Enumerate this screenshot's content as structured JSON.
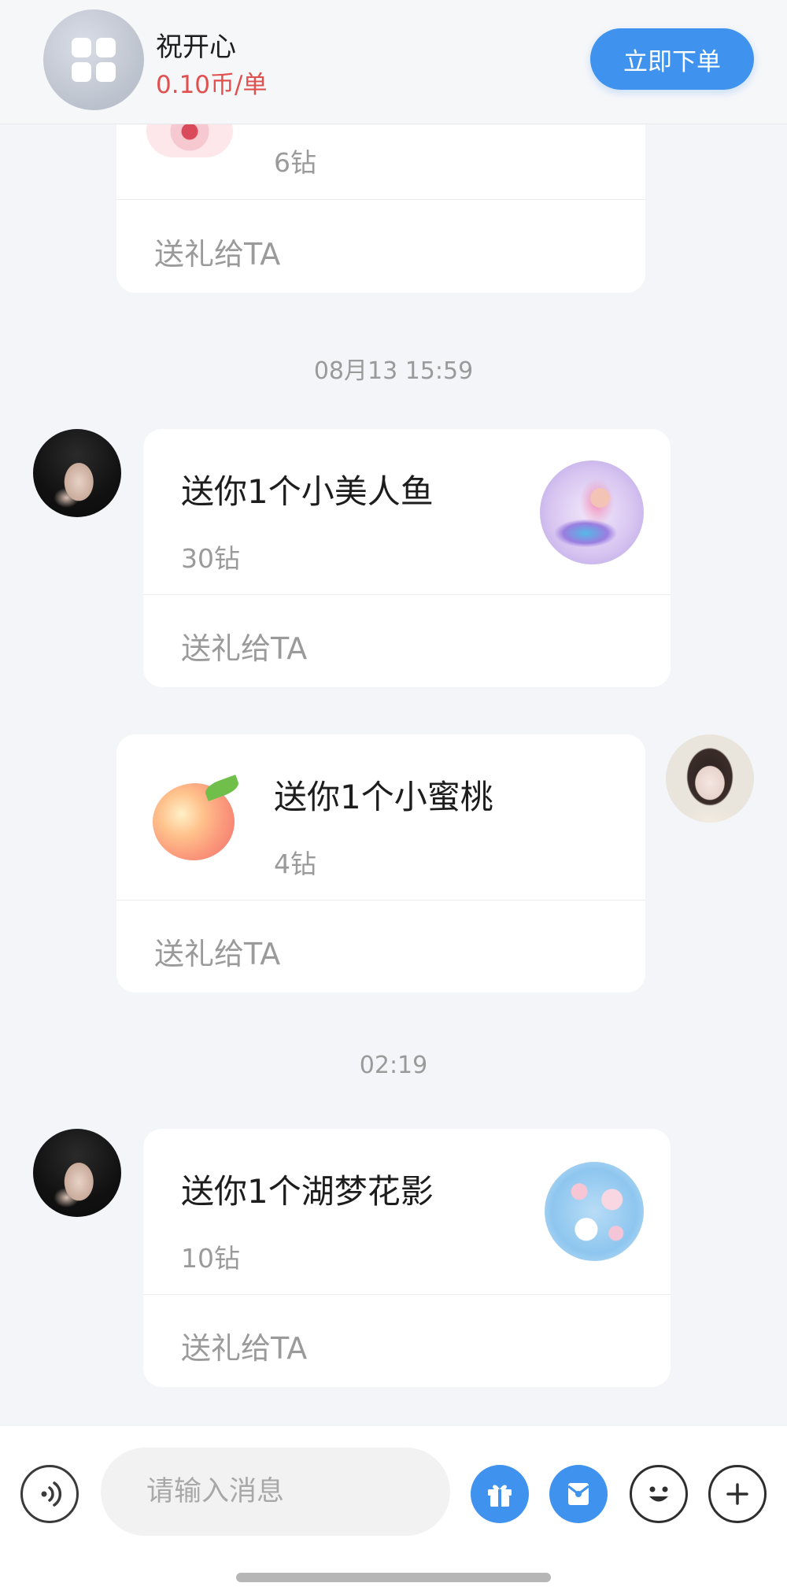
{
  "header": {
    "service_name": "祝开心",
    "price": "0.10币/单",
    "order_button": "立即下单"
  },
  "messages": {
    "gift_partial": {
      "price": "6钻",
      "send_link": "送礼给TA"
    },
    "timestamp_1": "08月13 15:59",
    "gift_mermaid": {
      "title": "送你1个小美人鱼",
      "price": "30钻",
      "send_link": "送礼给TA"
    },
    "gift_peach": {
      "title": "送你1个小蜜桃",
      "price": "4钻",
      "send_link": "送礼给TA"
    },
    "timestamp_2": "02:19",
    "gift_flower": {
      "title": "送你1个湖梦花影",
      "price": "10钻",
      "send_link": "送礼给TA"
    }
  },
  "input_bar": {
    "placeholder": "请输入消息",
    "icons": [
      "voice-icon",
      "gift-icon",
      "red-packet-icon",
      "emoji-icon",
      "plus-icon"
    ]
  },
  "colors": {
    "accent": "#3f92ee",
    "price_red": "#e0504f",
    "background": "#f3f5f8"
  }
}
